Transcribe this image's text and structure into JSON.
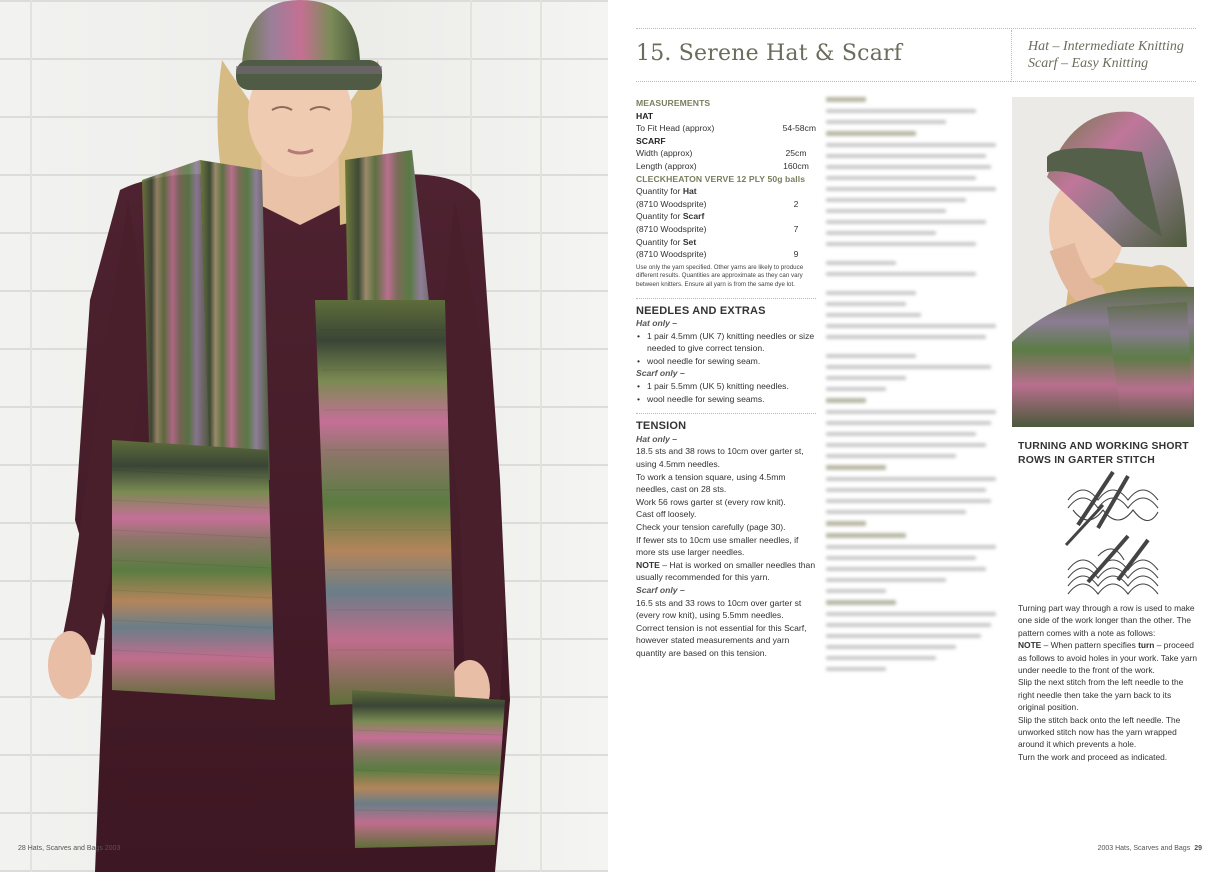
{
  "left_page": {
    "photo": "model-wearing-striped-hat-and-pocket-scarf",
    "footer": "28  Hats, Scarves and Bags 2003"
  },
  "right_page": {
    "title": "15. Serene Hat & Scarf",
    "difficulty": [
      "Hat – Intermediate Knitting",
      "Scarf – Easy Knitting"
    ],
    "measurements": {
      "heading": "MEASUREMENTS",
      "hat_label": "HAT",
      "hat_rows": [
        {
          "label": "To Fit Head (approx)",
          "value": "54-58cm"
        }
      ],
      "scarf_label": "SCARF",
      "scarf_rows": [
        {
          "label": "Width (approx)",
          "value": "25cm"
        },
        {
          "label": "Length (approx)",
          "value": "160cm"
        }
      ],
      "yarn_heading": "CLECKHEATON VERVE 12 PLY 50g balls",
      "quantities": [
        {
          "label": "Quantity for ",
          "item": "Hat",
          "colour": "(8710 Woodsprite)",
          "value": "2"
        },
        {
          "label": "Quantity for ",
          "item": "Scarf",
          "colour": "(8710 Woodsprite)",
          "value": "7"
        },
        {
          "label": "Quantity for ",
          "item": "Set",
          "colour": "(8710 Woodsprite)",
          "value": "9"
        }
      ],
      "note": "Use only the yarn specified. Other yarns are likely to produce different results. Quantities are approximate as they can vary between knitters. Ensure all yarn is from the same dye lot."
    },
    "needles": {
      "heading": "NEEDLES AND EXTRAS",
      "hat_only": "Hat only –",
      "hat_items": [
        "1 pair 4.5mm (UK 7) knitting needles or size needed to give correct tension.",
        "wool needle for sewing seam."
      ],
      "scarf_only": "Scarf only –",
      "scarf_items": [
        "1 pair 5.5mm (UK 5) knitting needles.",
        "wool needle for sewing seams."
      ]
    },
    "tension": {
      "heading": "TENSION",
      "hat_only": "Hat only –",
      "hat_lines": [
        "18.5 sts and 38 rows to 10cm over garter st, using 4.5mm needles.",
        "To work a tension square, using 4.5mm needles, cast on 28 sts.",
        "Work 56 rows garter st (every row knit).",
        "Cast off loosely.",
        "Check your tension carefully (page 30).",
        "If fewer sts to 10cm use smaller needles, if more sts use larger needles."
      ],
      "note_label": "NOTE",
      "note_text": " – Hat is worked on smaller needles than usually recommended for this yarn.",
      "scarf_only": "Scarf only –",
      "scarf_lines": [
        "16.5 sts and 33 rows to 10cm over garter st (every row knit), using 5.5mm needles.",
        "Correct tension is not essential for this Scarf, however stated measurements and yarn quantity are based on this tension."
      ]
    },
    "photo2": "model-profile-wearing-hat",
    "short_rows": {
      "heading": "TURNING AND WORKING SHORT ROWS IN GARTER STITCH",
      "diagram": "short-row-wrap-diagram",
      "intro": "Turning part way through a row is used to make one side of the work longer than the other. The pattern comes with a note as follows:",
      "note_label": "NOTE",
      "note_pre": " – When pattern specifies ",
      "note_bold": "turn",
      "note_post": " – proceed as follows to avoid holes in your work. Take yarn under needle to the front of the work.",
      "steps": [
        "Slip the next stitch from the left needle to the right needle then take the yarn back to its original position.",
        "Slip the stitch back onto the left needle. The unworked stitch now has the yarn wrapped around it which prevents a hole.",
        "Turn the work and proceed as indicated."
      ]
    },
    "footer_text": "2003 Hats, Scarves and Bags",
    "footer_page": "29"
  }
}
